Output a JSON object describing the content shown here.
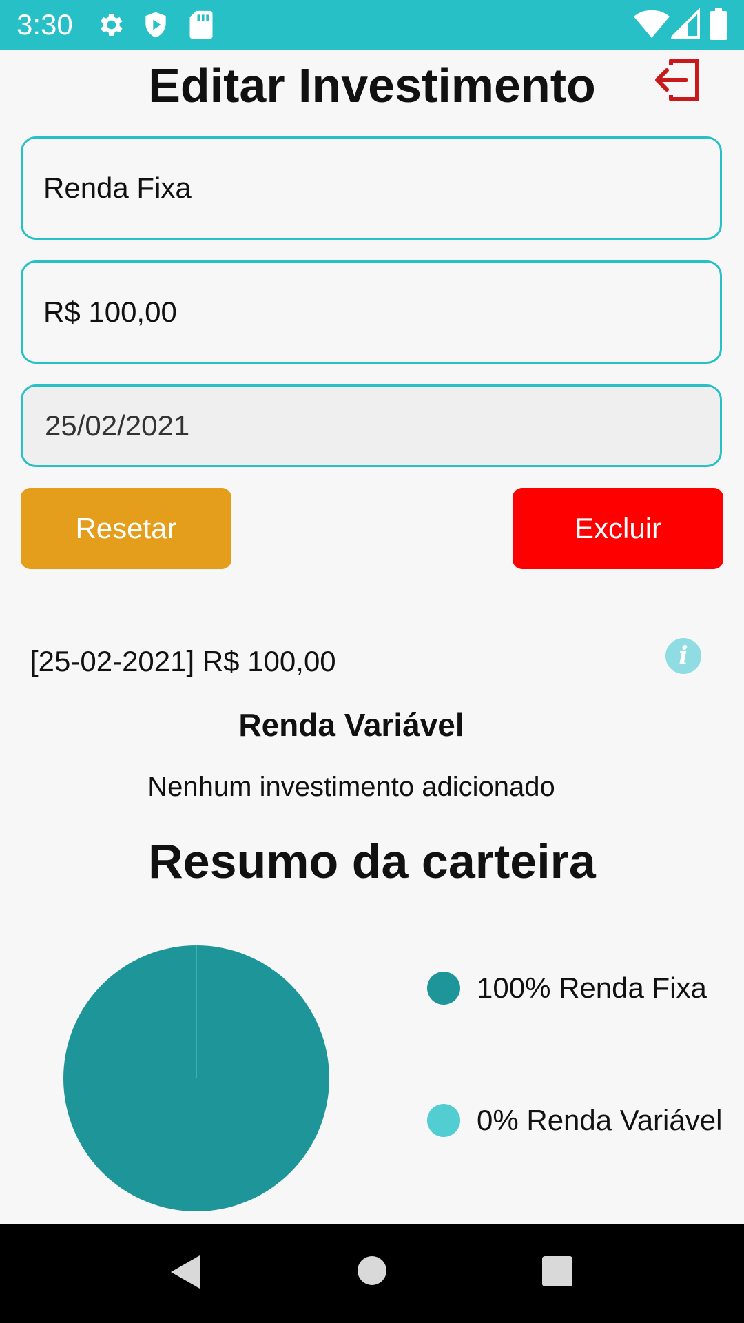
{
  "status_bar": {
    "time": "3:30",
    "left_icons": [
      "gear-icon",
      "shield-icon",
      "sd-card-icon"
    ],
    "right_icons": [
      "wifi-icon",
      "signal-icon",
      "battery-icon"
    ],
    "color": "#27c0c7"
  },
  "header": {
    "title": "Editar Investimento",
    "logout_icon": "logout-icon",
    "logout_color": "#c8191b"
  },
  "form": {
    "type_value": "Renda Fixa",
    "amount_value": "R$ 100,00",
    "date_value": "25/02/2021",
    "border_color": "#27c0c7"
  },
  "buttons": {
    "reset_label": "Resetar",
    "reset_color": "#e59e1b",
    "delete_label": "Excluir",
    "delete_color": "#ff0000"
  },
  "entries": {
    "fixed_income_entry": "[25-02-2021] R$ 100,00",
    "info_icon": "info-icon",
    "variable_heading": "Renda Variável",
    "variable_empty": "Nenhum investimento adicionado"
  },
  "summary": {
    "title": "Resumo da carteira"
  },
  "chart_data": {
    "type": "pie",
    "title": "",
    "slices": [
      {
        "label": "100% Renda Fixa",
        "value": 100,
        "color": "#1e9598"
      },
      {
        "label": "0% Renda Variável",
        "value": 0,
        "color": "#52cdd2"
      }
    ],
    "legend_position": "right"
  },
  "nav_bar": {
    "icons": [
      "back-icon",
      "home-icon",
      "recents-icon"
    ]
  }
}
